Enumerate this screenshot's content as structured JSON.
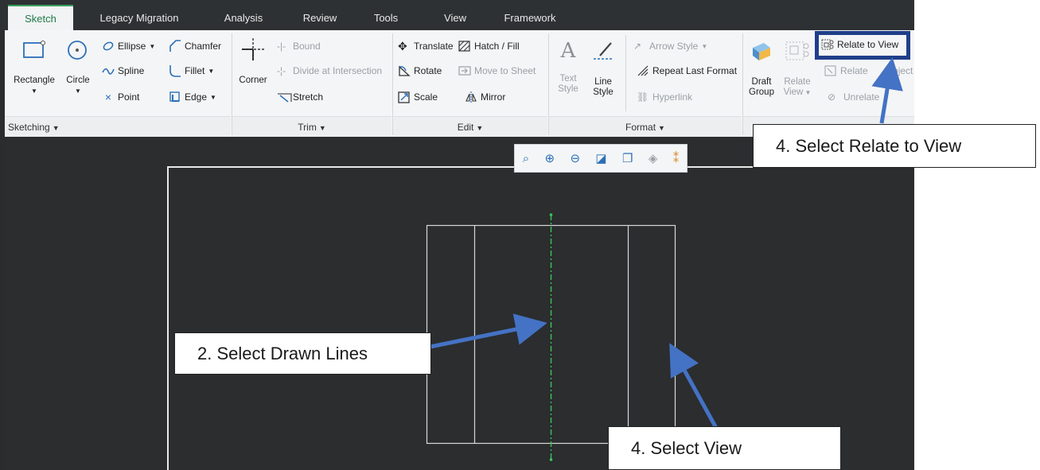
{
  "tabs": [
    "Sketch",
    "Legacy Migration",
    "Analysis",
    "Review",
    "Tools",
    "View",
    "Framework"
  ],
  "sketching": {
    "rectangle": "Rectangle",
    "circle": "Circle",
    "ellipse": "Ellipse",
    "spline": "Spline",
    "point": "Point",
    "chamfer": "Chamfer",
    "fillet": "Fillet",
    "edge": "Edge",
    "footer": "Sketching"
  },
  "trim": {
    "corner": "Corner",
    "bound": "Bound",
    "divide": "Divide at Intersection",
    "stretch": "Stretch",
    "footer": "Trim"
  },
  "edit": {
    "translate": "Translate",
    "hatch": "Hatch / Fill",
    "rotate": "Rotate",
    "move_to_sheet": "Move to Sheet",
    "scale": "Scale",
    "mirror": "Mirror",
    "footer": "Edit"
  },
  "format": {
    "text_style_1": "Text",
    "text_style_2": "Style",
    "line_style_1": "Line",
    "line_style_2": "Style",
    "arrow_style": "Arrow Style",
    "repeat_last_format": "Repeat Last Format",
    "hyperlink": "Hyperlink",
    "footer": "Format"
  },
  "group": {
    "draft_group_1": "Draft",
    "draft_group_2": "Group",
    "relate_view_1": "Relate",
    "relate_view_2": "View",
    "relate_to_view": "Relate to View",
    "relate_to_object_1": "Relate",
    "relate_to_object_2": "Object",
    "unrelate": "Unrelate"
  },
  "callouts": {
    "step_relate": "4.   Select Relate to View",
    "step_lines": "2.   Select Drawn Lines",
    "step_view": "4.   Select View"
  },
  "colors": {
    "accent": "#3a9c5f",
    "annotation_arrow": "#4472c4",
    "highlight_box": "#1f3f8a",
    "centerline": "#3cc45a"
  }
}
